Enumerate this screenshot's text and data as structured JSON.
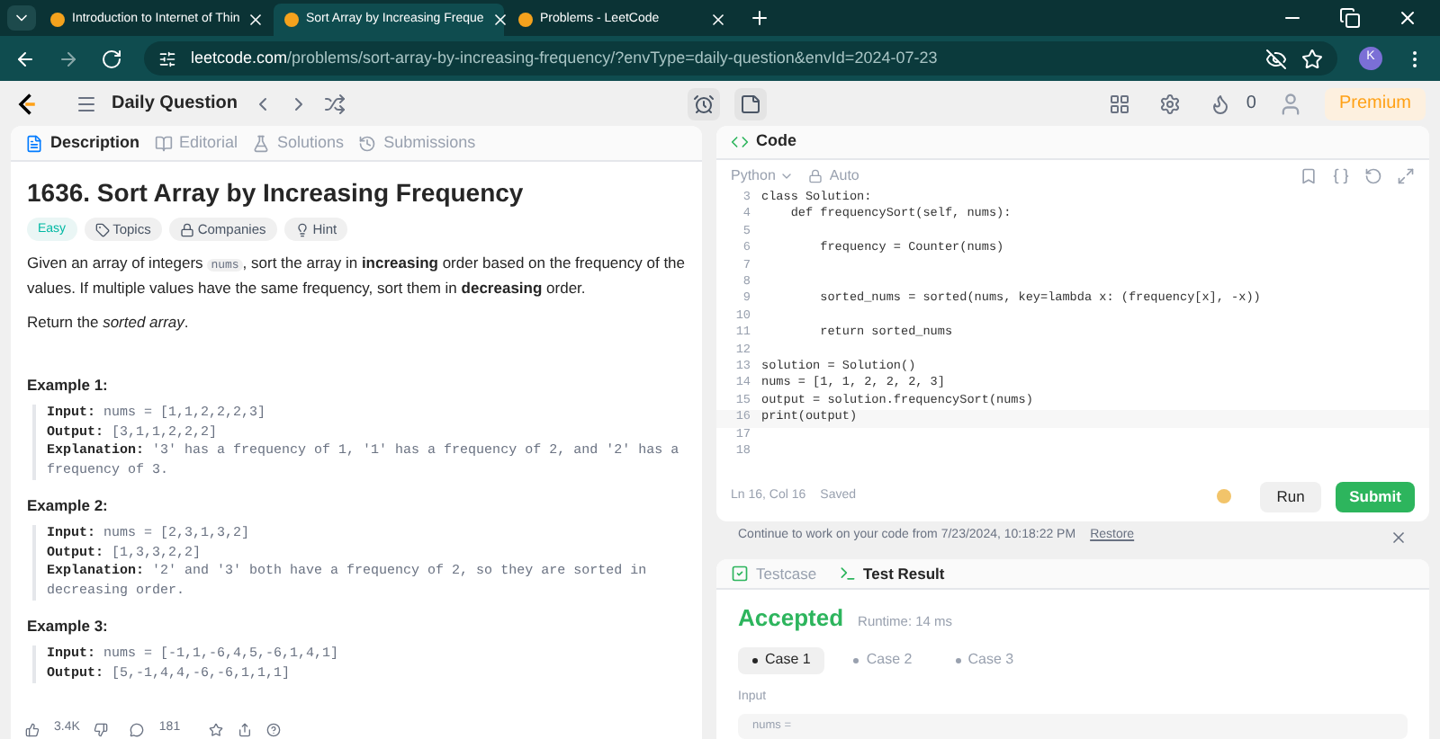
{
  "browser": {
    "tabs": [
      {
        "title": "Introduction to Internet of Thin",
        "selected": false
      },
      {
        "title": "Sort Array by Increasing Freque",
        "selected": true
      },
      {
        "title": "Problems - LeetCode",
        "selected": false
      }
    ],
    "address": {
      "domain": "leetcode.com",
      "path": "/problems/sort-array-by-increasing-frequency/?envType=daily-question&envId=2024-07-23"
    },
    "profile_initial": "K"
  },
  "navbar": {
    "title": "Daily Question",
    "streak": "0",
    "premium": "Premium"
  },
  "left_tabs": [
    {
      "label": "Description",
      "selected": true
    },
    {
      "label": "Editorial",
      "selected": false
    },
    {
      "label": "Solutions",
      "selected": false
    },
    {
      "label": "Submissions",
      "selected": false
    }
  ],
  "problem": {
    "title": "1636. Sort Array by Increasing Frequency",
    "difficulty": "Easy",
    "tags": [
      "Topics",
      "Companies",
      "Hint"
    ],
    "description": {
      "before": "Given an array of integers",
      "code": "nums",
      "after": ", sort the array in **increasing** order based on the frequency of the values. If multiple values have the same frequency, sort them in **decreasing** order."
    },
    "return_text": "Return the *sorted array*.",
    "examples": [
      {
        "title": "Example 1:",
        "lines": [
          {
            "label": "Input:",
            "text": "nums = [1,1,2,2,2,3]"
          },
          {
            "label": "Output:",
            "text": "[3,1,1,2,2,2]"
          },
          {
            "label": "Explanation:",
            "text": "'3' has a frequency of 1, '1' has a frequency of 2, and '2' has a frequency of 3."
          }
        ]
      },
      {
        "title": "Example 2:",
        "lines": [
          {
            "label": "Input:",
            "text": "nums = [2,3,1,3,2]"
          },
          {
            "label": "Output:",
            "text": "[1,3,3,2,2]"
          },
          {
            "label": "Explanation:",
            "text": "'2' and '3' both have a frequency of 2, so they are sorted in decreasing order."
          }
        ]
      },
      {
        "title": "Example 3:",
        "lines": [
          {
            "label": "Input:",
            "text": "nums = [-1,1,-6,4,5,-6,1,4,1]"
          },
          {
            "label": "Output:",
            "text": "[5,-1,4,4,-6,-6,1,1,1]"
          }
        ]
      }
    ],
    "likes": "3.4K",
    "comments": "181"
  },
  "editor": {
    "title": "Code",
    "language": "Python",
    "mode": "Auto",
    "lines": [
      {
        "number": "3",
        "code": "class Solution:"
      },
      {
        "number": "4",
        "code": "    def frequencySort(self, nums):"
      },
      {
        "number": "5"
      },
      {
        "number": "6",
        "code": "        frequency = Counter(nums)"
      },
      {
        "number": "7"
      },
      {
        "number": "8"
      },
      {
        "number": "9",
        "code": "        sorted_nums = sorted(nums, key=lambda x: (frequency[x], -x))"
      },
      {
        "number": "10"
      },
      {
        "number": "11",
        "code": "        return sorted_nums"
      },
      {
        "number": "12"
      },
      {
        "number": "13",
        "code": "solution = Solution()"
      },
      {
        "number": "14",
        "code": "nums = [1, 1, 2, 2, 2, 3]"
      },
      {
        "number": "15",
        "code": "output = solution.frequencySort(nums)"
      },
      {
        "number": "16",
        "code": "print(output)"
      },
      {
        "number": "17"
      },
      {
        "number": "18"
      }
    ],
    "cursor": "Ln 16, Col 16",
    "save_state": "Saved",
    "run": "Run",
    "submit": "Submit"
  },
  "restore_bar": {
    "text": "Continue to work on your code from 7/23/2024, 10:18:22 PM",
    "link": "Restore"
  },
  "results": {
    "tabs": [
      {
        "label": "Testcase",
        "selected": false
      },
      {
        "label": "Test Result",
        "selected": true
      }
    ],
    "status": "Accepted",
    "runtime": "Runtime: 14 ms",
    "cases": [
      {
        "label": "Case 1",
        "selected": true
      },
      {
        "label": "Case 2",
        "selected": false
      },
      {
        "label": "Case 3",
        "selected": false
      }
    ],
    "input_label": "Input",
    "input_value": "nums ="
  }
}
